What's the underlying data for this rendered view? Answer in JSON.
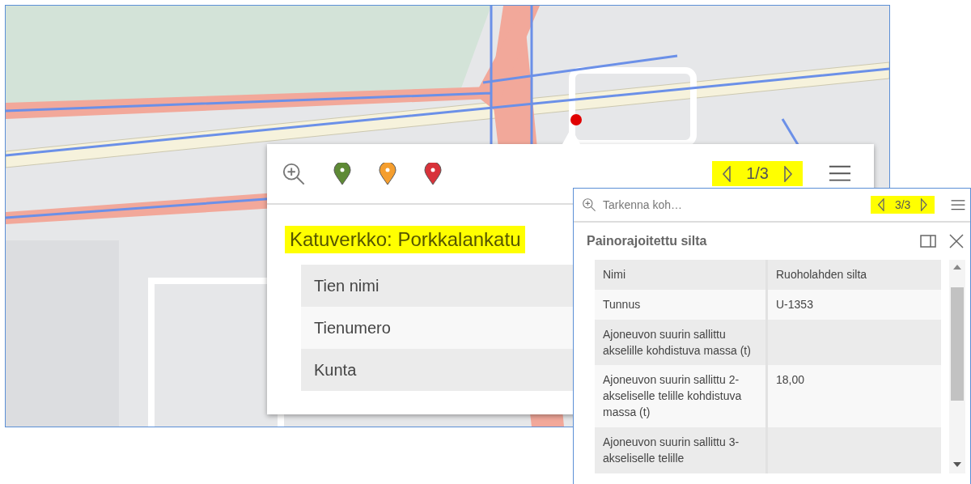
{
  "popup": {
    "markers": [
      {
        "color": "#5e8a35"
      },
      {
        "color": "#f59e2e"
      },
      {
        "color": "#d8323a"
      }
    ],
    "pager": "1/3",
    "title": "Katuverkko: Porkkalankatu",
    "rows": [
      "Tien nimi",
      "Tienumero",
      "Kunta"
    ]
  },
  "panel": {
    "search": {
      "placeholder": "Tarkenna koh…"
    },
    "pager": "3/3",
    "title": "Painorajoitettu silta",
    "rows": [
      {
        "label": "Nimi",
        "value": "Ruoholahden silta"
      },
      {
        "label": "Tunnus",
        "value": "U-1353"
      },
      {
        "label": "Ajoneuvon suurin sallittu akselille kohdistuva massa (t)"
      },
      {
        "label": "Ajoneuvon suurin sallittu 2-akseliselle telille kohdistuva massa (t)",
        "value": "18,00"
      },
      {
        "label": "Ajoneuvon suurin sallittu 3-akseliselle telille"
      }
    ]
  }
}
